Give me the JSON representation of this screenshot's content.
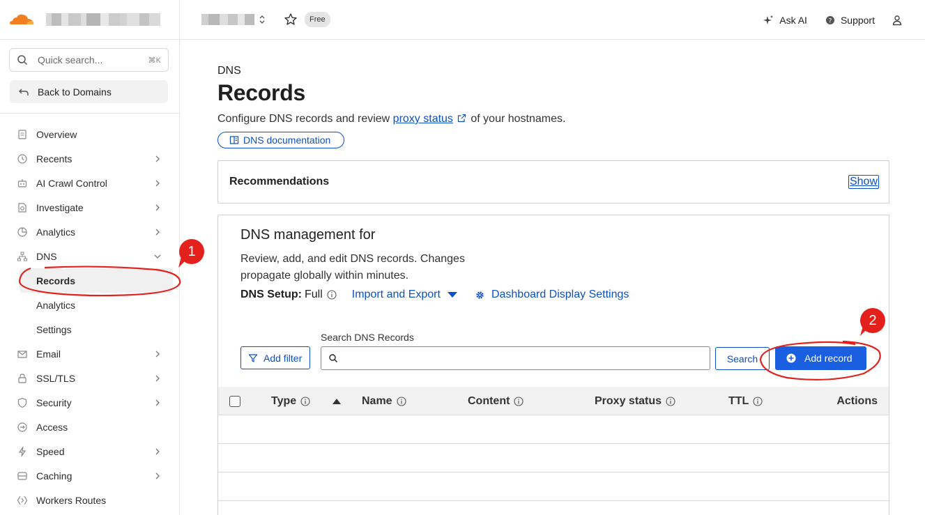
{
  "sidebar": {
    "search": {
      "placeholder": "Quick search...",
      "shortcut": "⌘K"
    },
    "back_label": "Back to Domains",
    "items": [
      {
        "label": "Overview",
        "icon": "document-icon",
        "chevron": false
      },
      {
        "label": "Recents",
        "icon": "clock-icon",
        "chevron": true
      },
      {
        "label": "AI Crawl Control",
        "icon": "robot-icon",
        "chevron": true
      },
      {
        "label": "Investigate",
        "icon": "search-doc-icon",
        "chevron": true
      },
      {
        "label": "Analytics",
        "icon": "chart-icon",
        "chevron": true
      },
      {
        "label": "DNS",
        "icon": "network-icon",
        "chevron": "down"
      }
    ],
    "dns_sub": [
      {
        "label": "Records",
        "active": true
      },
      {
        "label": "Analytics",
        "active": false
      },
      {
        "label": "Settings",
        "active": false
      }
    ],
    "items_after": [
      {
        "label": "Email",
        "icon": "mail-icon",
        "chevron": true
      },
      {
        "label": "SSL/TLS",
        "icon": "lock-icon",
        "chevron": true
      },
      {
        "label": "Security",
        "icon": "shield-icon",
        "chevron": true
      },
      {
        "label": "Access",
        "icon": "access-icon",
        "chevron": false
      },
      {
        "label": "Speed",
        "icon": "lightning-icon",
        "chevron": true
      },
      {
        "label": "Caching",
        "icon": "cache-icon",
        "chevron": true
      },
      {
        "label": "Workers Routes",
        "icon": "workers-icon",
        "chevron": false
      }
    ]
  },
  "topbar": {
    "plan_badge": "Free",
    "ask_ai": "Ask AI",
    "support": "Support"
  },
  "main": {
    "eyebrow": "DNS",
    "title": "Records",
    "desc_before": "Configure DNS records and review ",
    "desc_link": "proxy status",
    "desc_after": " of your hostnames.",
    "doc_button": "DNS documentation",
    "recommendations": {
      "title": "Recommendations",
      "show": "Show"
    },
    "management": {
      "title": "DNS management for",
      "desc": "Review, add, and edit DNS records. Changes propagate globally within minutes.",
      "setup_label": "DNS Setup:",
      "setup_value": "Full",
      "import_export": "Import and Export",
      "dashboard_settings": "Dashboard Display Settings",
      "search_label": "Search DNS Records",
      "add_filter": "Add filter",
      "search_button": "Search",
      "add_record": "Add record"
    },
    "table": {
      "columns": [
        "Type",
        "Name",
        "Content",
        "Proxy status",
        "TTL",
        "Actions"
      ]
    }
  },
  "annotations": {
    "step1": "1",
    "step2": "2"
  },
  "colors": {
    "accent": "#0b50c6",
    "primary_button": "#1a5fe0",
    "annotation": "#e3201b",
    "logo": "#f38020"
  }
}
